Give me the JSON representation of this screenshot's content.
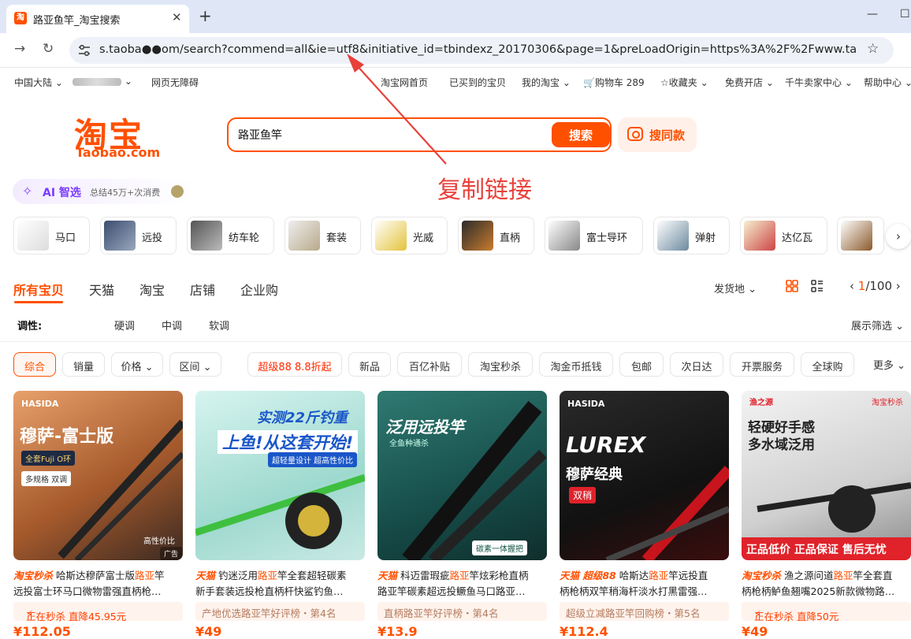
{
  "browser": {
    "tab_title": "路亚鱼竿_淘宝搜索",
    "favicon_text": "淘",
    "url": "s.taoba●●om/search?commend=all&ie=utf8&initiative_id=tbindexz_20170306&page=1&preLoadOrigin=https%3A%2F%2Fwww.taobao.com...",
    "icons": [
      "close-icon",
      "plus-icon",
      "minimize-icon",
      "maximize-icon",
      "forward-icon",
      "reload-icon",
      "site-settings-icon",
      "bookmark-star-icon"
    ]
  },
  "site_nav": {
    "region": "中国大陆",
    "accessible": "网页无障碍",
    "home": "淘宝网首页",
    "bought": "已买到的宝贝",
    "my_taobao": "我的淘宝",
    "cart": "购物车 289",
    "favorites": "收藏夹",
    "open_shop": "免费开店",
    "seller": "千牛卖家中心",
    "help": "帮助中心"
  },
  "logo": {
    "cn": "淘宝",
    "en": "Taobao.com",
    "color": "#ff5000"
  },
  "search": {
    "query": "路亚鱼竿",
    "button": "搜索",
    "same_style": "搜同款"
  },
  "annotation": {
    "text": "复制链接",
    "color": "#e8413a"
  },
  "ai": {
    "name": "AI 智选",
    "desc": "总结45万+次消费"
  },
  "categories": [
    {
      "label": "马口"
    },
    {
      "label": "远投"
    },
    {
      "label": "纺车轮"
    },
    {
      "label": "套装"
    },
    {
      "label": "光威"
    },
    {
      "label": "直柄"
    },
    {
      "label": "富士导环"
    },
    {
      "label": "弹射"
    },
    {
      "label": "达亿瓦"
    }
  ],
  "tabs": [
    "所有宝贝",
    "天猫",
    "淘宝",
    "店铺",
    "企业购"
  ],
  "ship_from": "发货地",
  "pager": {
    "current": "1",
    "total": "/100"
  },
  "filter": {
    "key": "调性:",
    "options": [
      "硬调",
      "中调",
      "软调"
    ],
    "expand": "展示筛选"
  },
  "sort": [
    "综合",
    "销量",
    "价格",
    "区间",
    "超级88 8.8折起",
    "新品",
    "百亿补贴",
    "淘宝秒杀",
    "淘金币抵钱",
    "包邮",
    "次日达",
    "开票服务",
    "全球购"
  ],
  "more": "更多",
  "products": [
    {
      "img_headline": "穆萨-富士版",
      "img_brand": "HASIDA",
      "img_sub": "全套Fuji O环",
      "img_pill": "多规格 双调",
      "img_corner": "高性价比",
      "ad": "广告",
      "tag": "淘宝秒杀",
      "line1": "哈斯达穆萨富士版",
      "kw1": "路亚",
      "line1b": "竿",
      "line2": "远投富士环马口微物雷强直柄枪…",
      "sub": "正在秒杀 直降45.95元",
      "price": "¥112.05"
    },
    {
      "img_headline": "实测22斤钓重",
      "img_sub": "上鱼!从这套开始!",
      "img_pill": "超轻量设计 超高性价比",
      "tag": "天猫",
      "line1": "钓迷泛用",
      "kw1": "路亚",
      "line1b": "竿全套超轻碳素",
      "line2": "新手套装远投枪直柄杆快鲨钓鱼…",
      "sub": "产地优选路亚竿好评榜・第4名",
      "price": "¥49"
    },
    {
      "img_headline": "泛用远投竿",
      "img_sub": "全鱼种通杀",
      "img_pill": "碳素一体握把",
      "tag": "天猫",
      "line1": "科迈雷瑕疵",
      "kw1": "路亚",
      "line1b": "竿炫彩枪直柄",
      "line2": "路亚竿碳素超远投鳜鱼马口路亚…",
      "sub": "直柄路亚竿好评榜・第4名",
      "price": "¥13.9"
    },
    {
      "img_headline": "LUREX",
      "img_brand": "HASIDA",
      "img_sub": "穆萨经典",
      "img_pill": "双稍",
      "tag": "天猫 超级88",
      "line1": "哈斯达",
      "kw1": "路亚",
      "line1b": "竿远投直",
      "line2": "柄枪柄双竿稍海杆淡水打黑雷强…",
      "sub": "超级立减路亚竿回购榜・第5名",
      "price": "¥112.4"
    },
    {
      "img_headline": "轻硬好手感",
      "img_sub": "多水域泛用",
      "img_brand": "渔之源",
      "img_pill": "淘宝秒杀",
      "img_bottom": "正品低价 正品保证 售后无忧",
      "tag": "淘宝秒杀",
      "line1": "渔之源问道",
      "kw1": "路亚",
      "line1b": "竿全套直",
      "line2": "柄枪柄鲈鱼翘嘴2025新款微物路…",
      "sub": "正在秒杀 直降50元",
      "price": "¥49"
    }
  ]
}
